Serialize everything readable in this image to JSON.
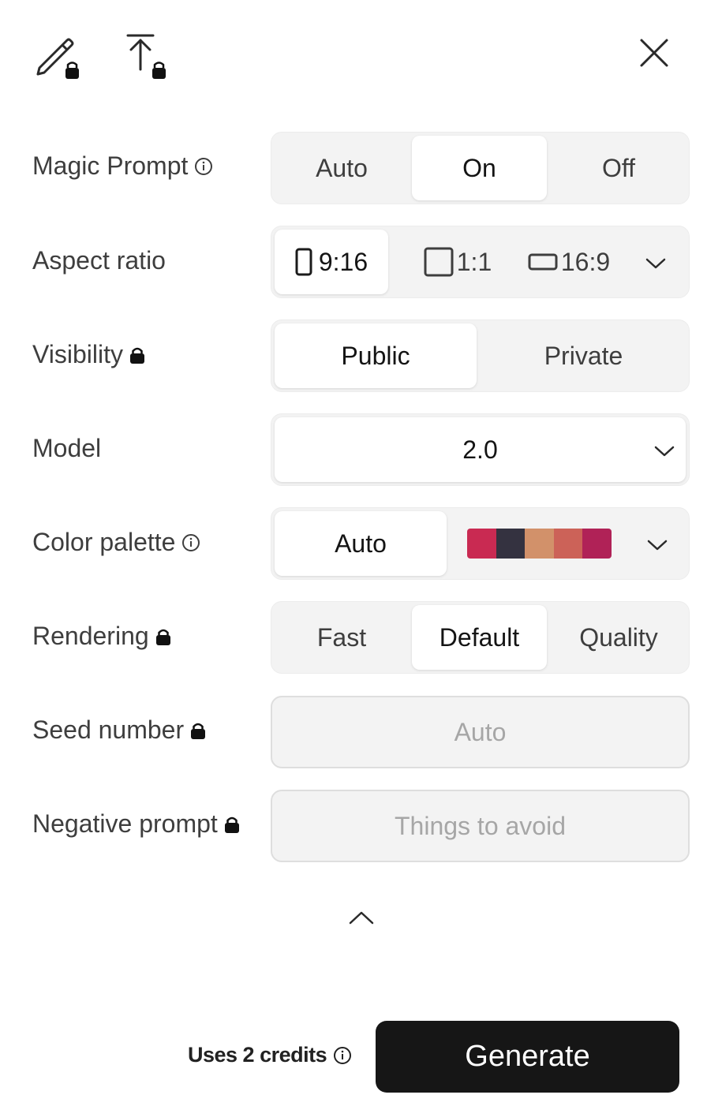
{
  "toolbar": {
    "edit_icon": "pencil-lock-icon",
    "upload_icon": "upload-lock-icon",
    "close_icon": "close-icon"
  },
  "magic_prompt": {
    "label": "Magic Prompt",
    "options": [
      "Auto",
      "On",
      "Off"
    ],
    "selected": "On"
  },
  "aspect_ratio": {
    "label": "Aspect ratio",
    "options": [
      "9:16",
      "1:1",
      "16:9"
    ],
    "selected": "9:16"
  },
  "visibility": {
    "label": "Visibility",
    "options": [
      "Public",
      "Private"
    ],
    "selected": "Public"
  },
  "model": {
    "label": "Model",
    "value": "2.0"
  },
  "color_palette": {
    "label": "Color palette",
    "auto_label": "Auto",
    "selected": "Auto",
    "swatches": [
      "#c92a52",
      "#343240",
      "#d2916a",
      "#cc6258",
      "#b02257"
    ]
  },
  "rendering": {
    "label": "Rendering",
    "options": [
      "Fast",
      "Default",
      "Quality"
    ],
    "selected": "Default"
  },
  "seed": {
    "label": "Seed number",
    "placeholder": "Auto",
    "value": ""
  },
  "negative_prompt": {
    "label": "Negative prompt",
    "placeholder": "Things to avoid",
    "value": ""
  },
  "footer": {
    "credits_text": "Uses 2 credits",
    "generate_label": "Generate"
  },
  "colors": {
    "accent": "#161616",
    "segment_bg": "#f3f3f3"
  }
}
